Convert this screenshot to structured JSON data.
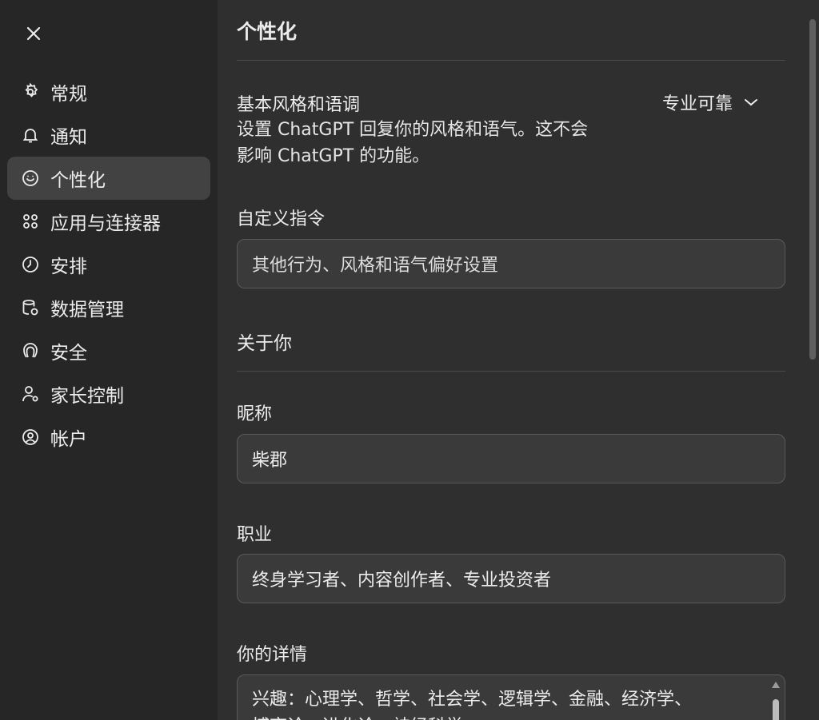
{
  "sidebar": {
    "close_icon": "close-icon",
    "items": [
      {
        "label": "常规",
        "icon": "gear-icon"
      },
      {
        "label": "通知",
        "icon": "bell-icon"
      },
      {
        "label": "个性化",
        "icon": "personalize-icon",
        "active": true
      },
      {
        "label": "应用与连接器",
        "icon": "apps-icon"
      },
      {
        "label": "安排",
        "icon": "clock-icon"
      },
      {
        "label": "数据管理",
        "icon": "database-gear-icon"
      },
      {
        "label": "安全",
        "icon": "security-icon"
      },
      {
        "label": "家长控制",
        "icon": "parent-control-icon"
      },
      {
        "label": "帐户",
        "icon": "account-icon"
      }
    ]
  },
  "main": {
    "title": "个性化",
    "base_style": {
      "label": "基本风格和语调",
      "description": "设置 ChatGPT 回复你的风格和语气。这不会影响 ChatGPT 的功能。",
      "description_line1": "设置 ChatGPT 回复你的风格和语气。这不会",
      "description_line2": "影响 ChatGPT 的功能。",
      "selected": "专业可靠"
    },
    "custom_instructions": {
      "label": "自定义指令",
      "placeholder": "其他行为、风格和语气偏好设置"
    },
    "about_you": {
      "heading": "关于你",
      "nickname": {
        "label": "昵称",
        "value": "柴郡"
      },
      "occupation": {
        "label": "职业",
        "value": "终身学习者、内容创作者、专业投资者"
      },
      "details": {
        "label": "你的详情",
        "value_line1": "兴趣：心理学、哲学、社会学、逻辑学、金融、经济学、",
        "value_line2": "博弈论、进化论、神经科学"
      }
    }
  },
  "colors": {
    "background": "#2f2f2f",
    "sidebar": "#262626",
    "active_item": "#424242",
    "input_bg": "#3a3a3a",
    "text": "#ececec"
  }
}
